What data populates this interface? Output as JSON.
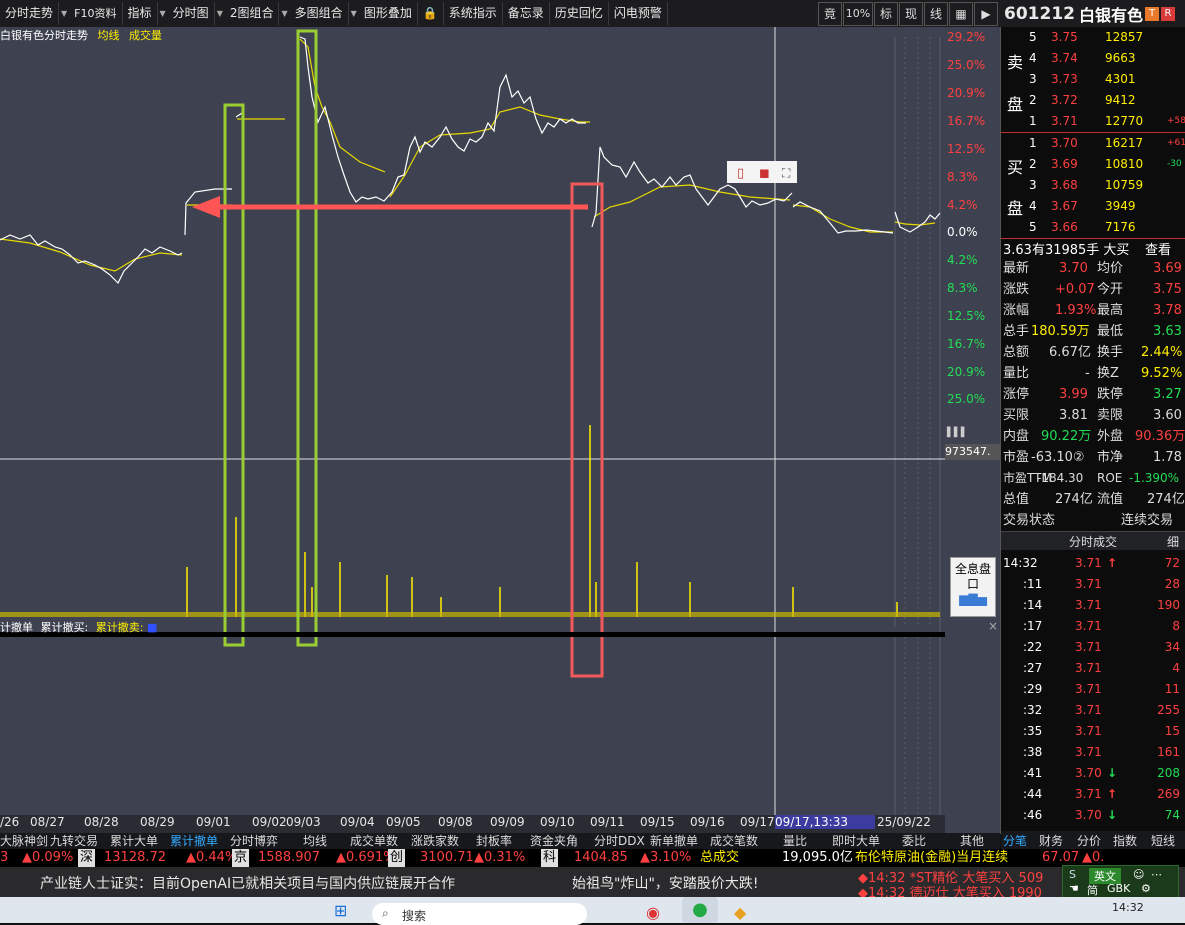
{
  "toolbar": {
    "buttons": [
      "分时走势",
      "F10资料",
      "指标",
      "分时图",
      "2图组合",
      "多图组合",
      "图形叠加",
      "系统指示",
      "备忘录",
      "历史回忆",
      "闪电预警"
    ],
    "right_buttons": [
      "竟",
      "10%",
      "标",
      "现",
      "线"
    ]
  },
  "stock": {
    "code": "601212",
    "name": "白银有色",
    "tag1": "T",
    "tag2": "R"
  },
  "chart": {
    "title": "白银有色分时走势",
    "legend_avg": "均线",
    "legend_vol": "成交量",
    "pct_labels_up": [
      "29.2%",
      "25.0%",
      "20.9%",
      "16.7%",
      "12.5%",
      "8.3%",
      "4.2%",
      "0.0%"
    ],
    "pct_labels_down": [
      "4.2%",
      "8.3%",
      "12.5%",
      "16.7%",
      "20.9%",
      "25.0%"
    ],
    "volume_value": "973547.",
    "indicator_label_a": "计撤单",
    "indicator_label_b": "累计撤买:",
    "indicator_label_c": "累计撤卖:",
    "dates": [
      "/26",
      "08/27",
      "08/28",
      "08/29",
      "09/01",
      "09/02",
      "09/03",
      "09/04",
      "09/05",
      "09/08",
      "09/09",
      "09/10",
      "09/11",
      "09/12",
      "09/15",
      "09/16",
      "09/17",
      "25/09/22"
    ],
    "crosshair_label": "09/17,13:33",
    "fullview_btn": "全息盘口"
  },
  "orderbook": {
    "sell_label": [
      "卖",
      "盘"
    ],
    "buy_label": [
      "买",
      "盘"
    ],
    "sell": [
      {
        "lvl": "5",
        "price": "3.75",
        "vol": "12857",
        "extra": ""
      },
      {
        "lvl": "4",
        "price": "3.74",
        "vol": "9663",
        "extra": ""
      },
      {
        "lvl": "3",
        "price": "3.73",
        "vol": "4301",
        "extra": ""
      },
      {
        "lvl": "2",
        "price": "3.72",
        "vol": "9412",
        "extra": ""
      },
      {
        "lvl": "1",
        "price": "3.71",
        "vol": "12770",
        "extra": "+58"
      }
    ],
    "buy": [
      {
        "lvl": "1",
        "price": "3.70",
        "vol": "16217",
        "extra": "+61"
      },
      {
        "lvl": "2",
        "price": "3.69",
        "vol": "10810",
        "extra": "-30"
      },
      {
        "lvl": "3",
        "price": "3.68",
        "vol": "10759",
        "extra": ""
      },
      {
        "lvl": "4",
        "price": "3.67",
        "vol": "3949",
        "extra": ""
      },
      {
        "lvl": "5",
        "price": "3.66",
        "vol": "7176",
        "extra": ""
      }
    ]
  },
  "bigorder": {
    "text": "3.63有31985手 大买",
    "link": "查看"
  },
  "stats": [
    {
      "l1": "最新",
      "v1": "3.70",
      "l2": "均价",
      "v2": "3.69"
    },
    {
      "l1": "涨跌",
      "v1": "+0.07",
      "l2": "今开",
      "v2": "3.75"
    },
    {
      "l1": "涨幅",
      "v1": "1.93%",
      "l2": "最高",
      "v2": "3.78"
    },
    {
      "l1": "总手",
      "v1": "180.59万",
      "l2": "最低",
      "v2": "3.63"
    },
    {
      "l1": "总额",
      "v1": "6.67亿",
      "l2": "换手",
      "v2": "2.44%"
    },
    {
      "l1": "量比",
      "v1": "-",
      "l2": "换Z",
      "v2": "9.52%"
    },
    {
      "l1": "涨停",
      "v1": "3.99",
      "l2": "跌停",
      "v2": "3.27"
    },
    {
      "l1": "买限",
      "v1": "3.81",
      "l2": "卖限",
      "v2": "3.60"
    },
    {
      "l1": "内盘",
      "v1": "90.22万",
      "l2": "外盘",
      "v2": "90.36万"
    },
    {
      "l1": "市盈",
      "v1": "-63.10②",
      "l2": "市净",
      "v2": "1.78"
    },
    {
      "l1": "市盈TTM",
      "v1": "-184.30",
      "l2": "ROE",
      "v2": "-1.390%"
    },
    {
      "l1": "总值",
      "v1": "274亿",
      "l2": "流值",
      "v2": "274亿"
    },
    {
      "l1": "交易状态",
      "v1": "",
      "l2": "",
      "v2": "连续交易"
    }
  ],
  "ticks_header": {
    "title": "分时成交",
    "detail": "细"
  },
  "ticks": [
    {
      "time": "14:32",
      "price": "3.71",
      "dir": "up",
      "vol": "72"
    },
    {
      "time": ":11",
      "price": "3.71",
      "dir": "",
      "vol": "28"
    },
    {
      "time": ":14",
      "price": "3.71",
      "dir": "",
      "vol": "190"
    },
    {
      "time": ":17",
      "price": "3.71",
      "dir": "",
      "vol": "8"
    },
    {
      "time": ":22",
      "price": "3.71",
      "dir": "",
      "vol": "34"
    },
    {
      "time": ":27",
      "price": "3.71",
      "dir": "",
      "vol": "4"
    },
    {
      "time": ":29",
      "price": "3.71",
      "dir": "",
      "vol": "11"
    },
    {
      "time": ":32",
      "price": "3.71",
      "dir": "",
      "vol": "255"
    },
    {
      "time": ":35",
      "price": "3.71",
      "dir": "",
      "vol": "15"
    },
    {
      "time": ":38",
      "price": "3.71",
      "dir": "",
      "vol": "161"
    },
    {
      "time": ":41",
      "price": "3.70",
      "dir": "down",
      "vol": "208"
    },
    {
      "time": ":44",
      "price": "3.71",
      "dir": "up",
      "vol": "269"
    },
    {
      "time": ":46",
      "price": "3.70",
      "dir": "down",
      "vol": "74"
    }
  ],
  "bottom_tabs": [
    "大脉神剑",
    "九转交易",
    "累计大单",
    "累计撤单",
    "分时博弈",
    "均线",
    "成交单数",
    "涨跌家数",
    "封板率",
    "资金夹角",
    "分时DDX",
    "新单撤单",
    "成交笔数",
    "量比",
    "即时大单",
    "委比",
    "其他"
  ],
  "right_tabs": [
    "分笔",
    "财务",
    "分价",
    "指数",
    "短线"
  ],
  "ticker": [
    {
      "text": "3",
      "cls": "red"
    },
    {
      "text": "▲0.09%",
      "cls": "red"
    },
    {
      "text": "深",
      "cls": "white"
    },
    {
      "text": "13128.72",
      "cls": "red"
    },
    {
      "text": "▲0.44%",
      "cls": "red"
    },
    {
      "text": "京",
      "cls": "white"
    },
    {
      "text": "1588.907",
      "cls": "red"
    },
    {
      "text": "▲0.691%",
      "cls": "red"
    },
    {
      "text": "创",
      "cls": "white"
    },
    {
      "text": "3100.71",
      "cls": "red"
    },
    {
      "text": "▲0.31%",
      "cls": "red"
    },
    {
      "text": "科",
      "cls": "white"
    },
    {
      "text": "1404.85",
      "cls": "red"
    },
    {
      "text": "▲3.10%",
      "cls": "red"
    },
    {
      "text": "总成交",
      "cls": "yellow"
    },
    {
      "text": "19,095.0亿",
      "cls": "white"
    },
    {
      "text": "布伦特原油(金融)当月连续",
      "cls": "yellow"
    },
    {
      "text": "67.07",
      "cls": "red"
    },
    {
      "text": "▲0.",
      "cls": "red"
    }
  ],
  "news": {
    "left": "产业链人士证实：目前OpenAI已就相关项目与国内供应链展开合作",
    "mid": "始祖鸟\"炸山\"，安踏股价大跌!",
    "alert1": "◆14:32  *ST精伦 大笔买入 509",
    "alert2": "◆14:32  德迈仕 大笔买入 1990"
  },
  "ime": {
    "lang": "英文",
    "mode": "简",
    "code": "GBK"
  },
  "taskbar": {
    "search": "搜索",
    "clock": "14:32"
  },
  "colors": {
    "up": "#ff4040",
    "down": "#22dd55",
    "price_line": "#ffffff",
    "avg_line": "#ffee00",
    "box_green": "#9acd32",
    "box_red": "#f25a5a",
    "arrow": "#ff5555"
  }
}
